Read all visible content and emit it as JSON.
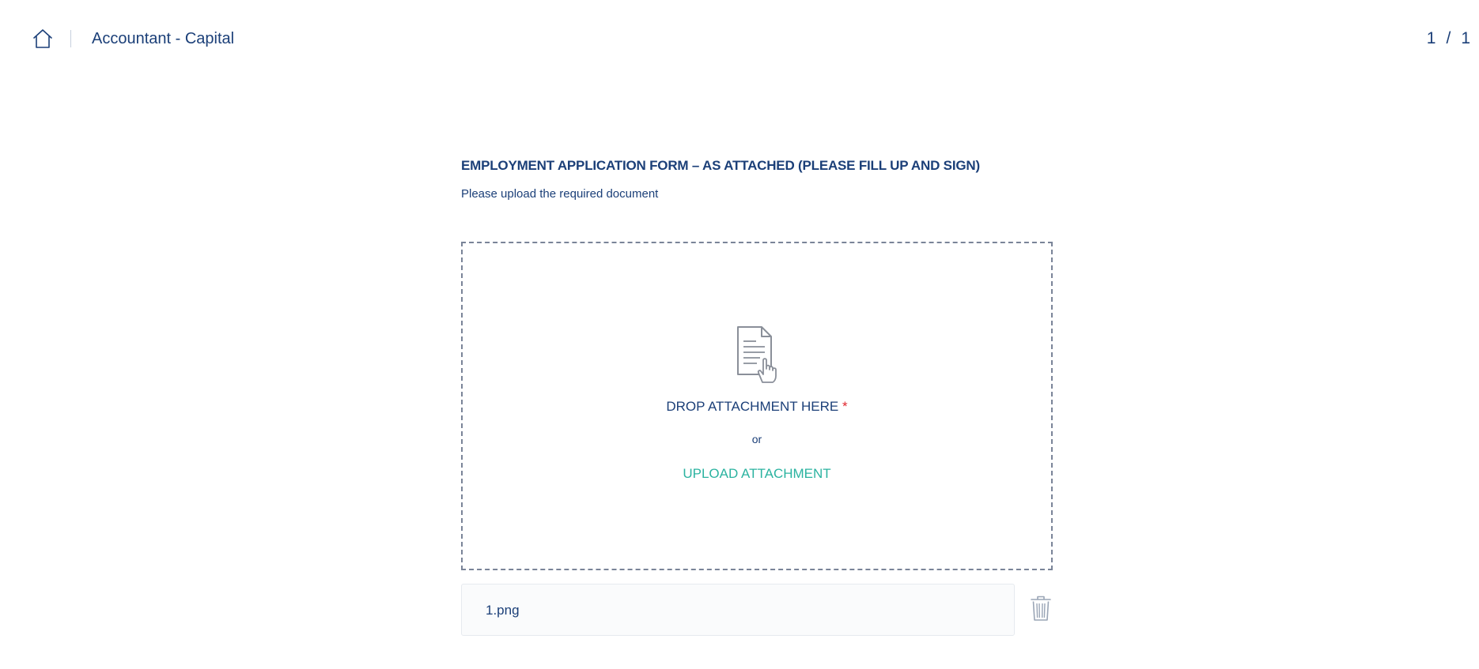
{
  "header": {
    "home_icon": "home-icon",
    "breadcrumb_title": "Accountant - Capital",
    "page_current": "1",
    "page_separator": "/",
    "page_total": "1"
  },
  "form": {
    "title": "EMPLOYMENT APPLICATION FORM – AS ATTACHED (PLEASE FILL UP AND SIGN)",
    "subtitle": "Please upload the required document",
    "dropzone": {
      "icon": "document-hand-icon",
      "drop_label": "DROP ATTACHMENT HERE",
      "required_marker": "*",
      "or_label": "or",
      "upload_label": "UPLOAD ATTACHMENT"
    },
    "attachment": {
      "file_name": "1.png",
      "delete_icon": "trash-icon"
    }
  },
  "colors": {
    "primary_text": "#1b3f78",
    "accent": "#2bb3a0",
    "required": "#e0262d",
    "dropzone_border": "#7a8498",
    "icon_gray": "#8a8f99"
  }
}
